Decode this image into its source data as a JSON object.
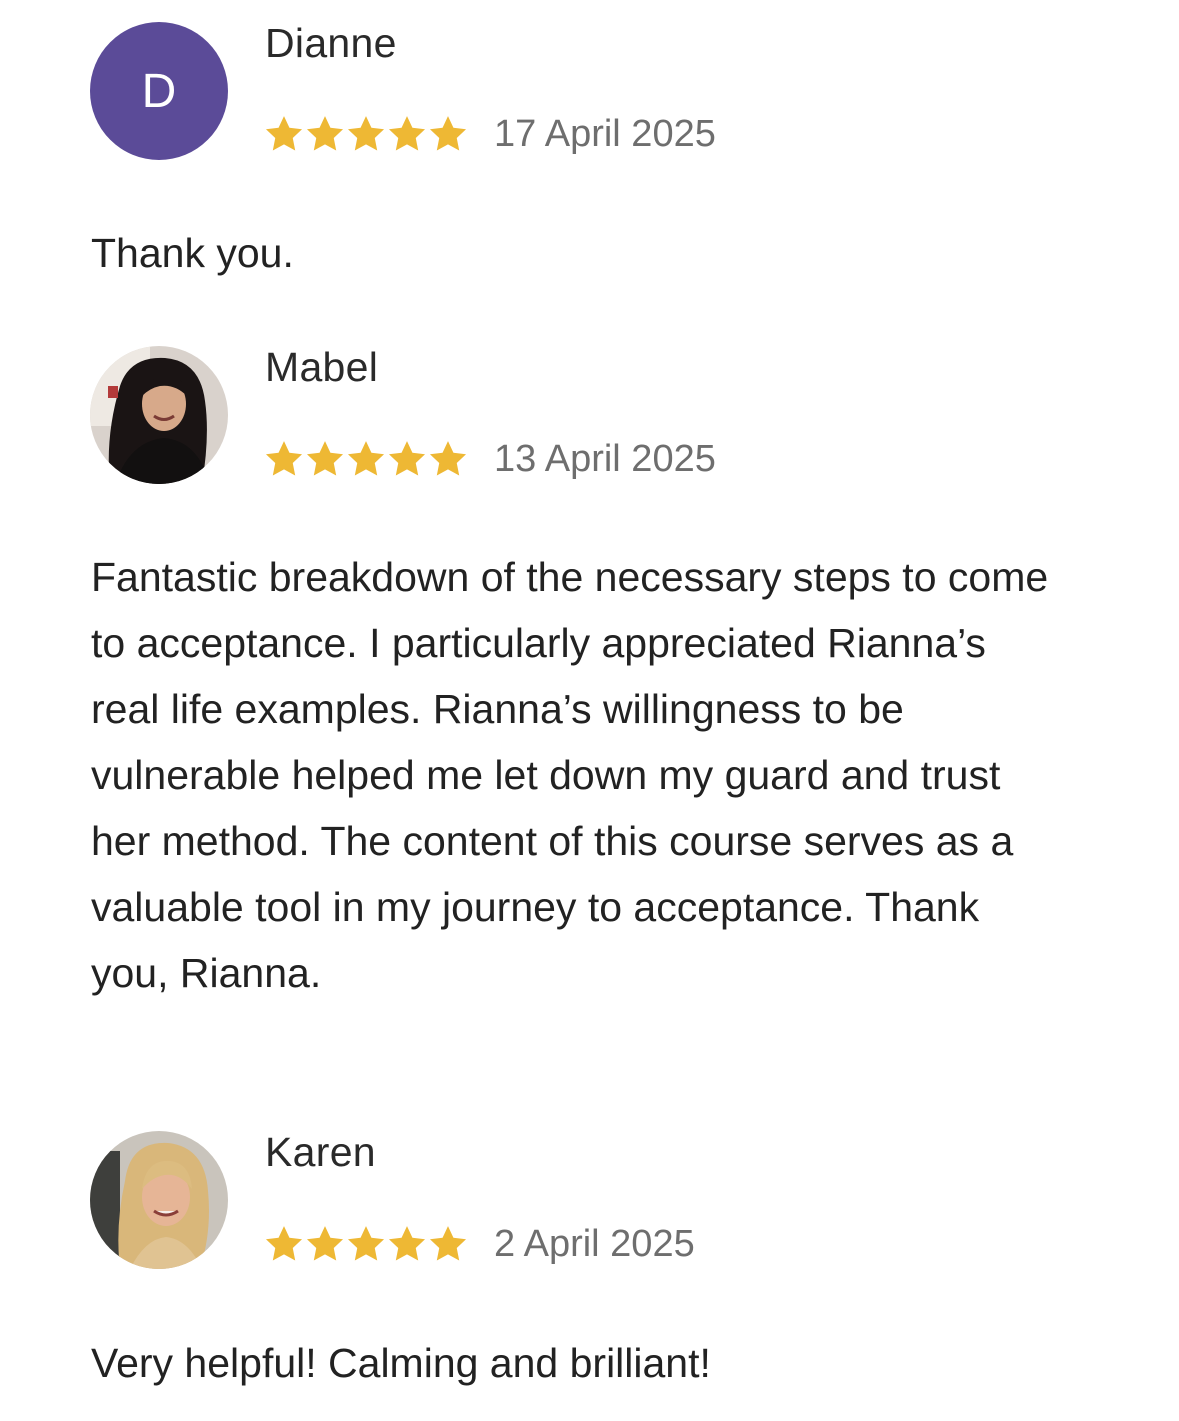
{
  "reviews": [
    {
      "name": "Dianne",
      "avatar_initial": "D",
      "avatar_type": "initial",
      "avatar_color": "#5b4b98",
      "rating": 5,
      "date": "17 April 2025",
      "text": "Thank you."
    },
    {
      "name": "Mabel",
      "avatar_type": "photo",
      "rating": 5,
      "date": "13 April 2025",
      "text": "Fantastic breakdown of the necessary steps to come to acceptance. I particularly appreciated Rianna’s real life examples. Rianna’s willingness to be vulnerable helped me let down my guard and trust her method. The content of this course serves as a valuable tool in my journey to acceptance. Thank you, Rianna."
    },
    {
      "name": "Karen",
      "avatar_type": "photo",
      "rating": 5,
      "date": "2 April 2025",
      "text": "Very helpful! Calming and brilliant!"
    }
  ],
  "colors": {
    "star": "#eeb834",
    "date": "#6e6e6e",
    "text": "#222222"
  }
}
